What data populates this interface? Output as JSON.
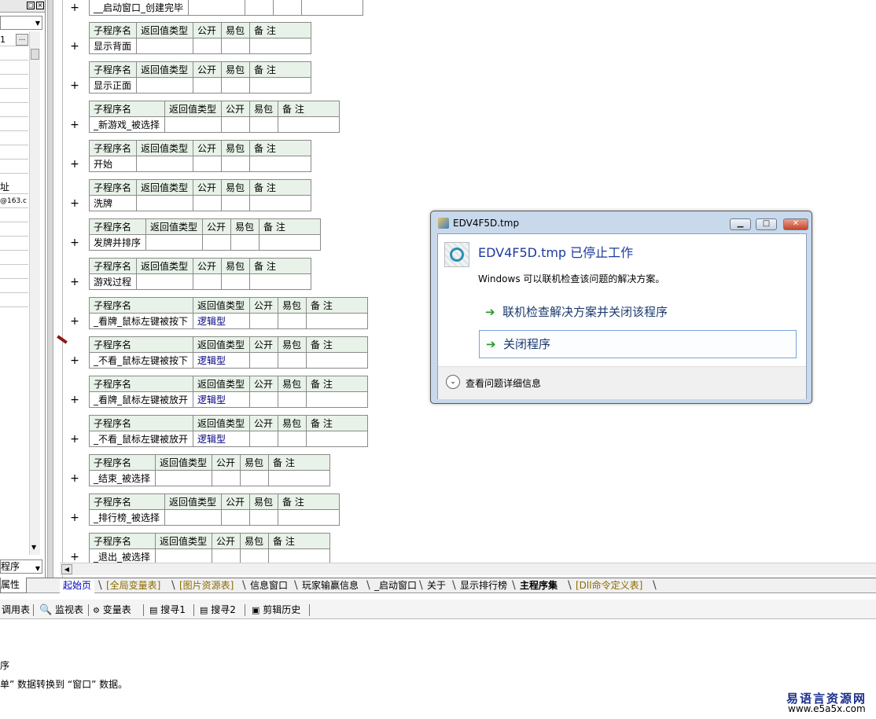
{
  "left_panel": {
    "row_value_1": "1",
    "row_more_label": "...",
    "address_label": "址",
    "email_partial": "@163.c",
    "dropdown_label": "程序",
    "properties_tab": "属性"
  },
  "code": {
    "top_row_label": "__启动窗口_创建完毕",
    "headers": {
      "name": "子程序名",
      "return_type": "返回值类型",
      "public": "公开",
      "easy_pack": "易包",
      "remarks": "备 注"
    },
    "subs": [
      {
        "name": "显示背面",
        "return_type": ""
      },
      {
        "name": "显示正面",
        "return_type": ""
      },
      {
        "name": "_新游戏_被选择",
        "return_type": ""
      },
      {
        "name": "开始",
        "return_type": ""
      },
      {
        "name": "洗牌",
        "return_type": ""
      },
      {
        "name": "发牌并排序",
        "return_type": ""
      },
      {
        "name": "游戏过程",
        "return_type": ""
      },
      {
        "name": "_看牌_鼠标左键被按下",
        "return_type": "逻辑型"
      },
      {
        "name": "_不看_鼠标左键被按下",
        "return_type": "逻辑型"
      },
      {
        "name": "_看牌_鼠标左键被放开",
        "return_type": "逻辑型"
      },
      {
        "name": "_不看_鼠标左键被放开",
        "return_type": "逻辑型"
      },
      {
        "name": "_结束_被选择",
        "return_type": ""
      },
      {
        "name": "_排行榜_被选择",
        "return_type": ""
      },
      {
        "name": "_退出_被选择",
        "return_type": ""
      }
    ]
  },
  "tabs": [
    {
      "label": "起始页"
    },
    {
      "label": "[全局变量表]"
    },
    {
      "label": "[图片资源表]"
    },
    {
      "label": "信息窗口"
    },
    {
      "label": "玩家输赢信息"
    },
    {
      "label": "_启动窗口"
    },
    {
      "label": "关于"
    },
    {
      "label": "显示排行榜"
    },
    {
      "label": "主程序集"
    },
    {
      "label": "[Dll命令定义表]"
    }
  ],
  "toolbar": {
    "call_table": "调用表",
    "watch_table": "监视表",
    "var_table": "变量表",
    "search1": "搜寻1",
    "search2": "搜寻2",
    "clip_history": "剪辑历史"
  },
  "output": {
    "line1": "序",
    "line2": "单” 数据转换到 “窗口” 数据。"
  },
  "watermark": {
    "title": "易语言资源网",
    "url": "www.e5a5x.com"
  },
  "dialog": {
    "title": "EDV4F5D.tmp",
    "heading": "EDV4F5D.tmp 已停止工作",
    "message": "Windows 可以联机检查该问题的解决方案。",
    "option1": "联机检查解决方案并关闭该程序",
    "option2": "关闭程序",
    "details": "查看问题详细信息"
  },
  "colors": {
    "header_bg": "#e8f2e8",
    "return_type_text": "#000080",
    "dialog_link": "#1c3a6e",
    "watermark_title": "#1a2f8a"
  }
}
